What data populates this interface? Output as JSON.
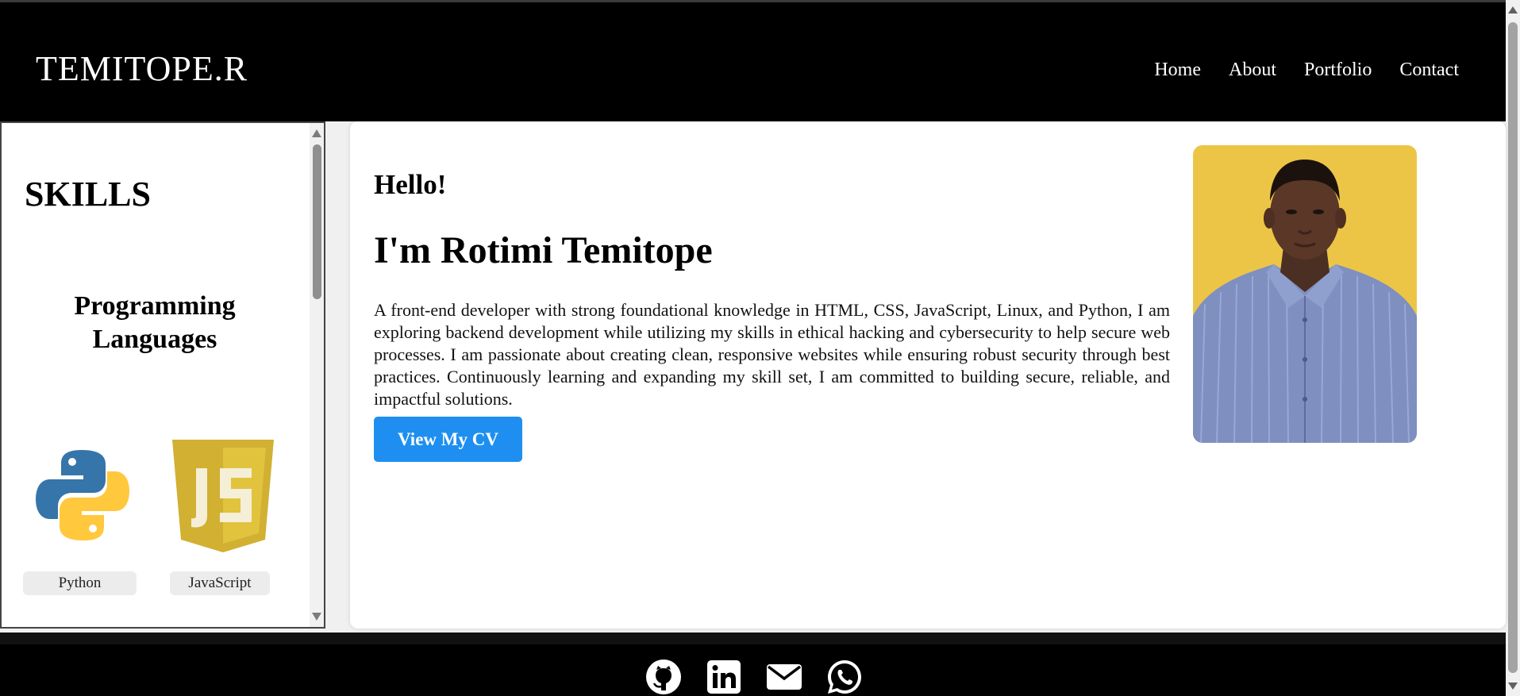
{
  "header": {
    "brand": "TEMITOPE.R",
    "nav": [
      "Home",
      "About",
      "Portfolio",
      "Contact"
    ]
  },
  "skills": {
    "title": "SKILLS",
    "section": "Programming Languages",
    "items": [
      {
        "label": "Python",
        "icon": "python-icon"
      },
      {
        "label": "JavaScript",
        "icon": "javascript-icon"
      }
    ]
  },
  "main": {
    "greeting": "Hello!",
    "name": "I'm Rotimi Temitope",
    "bio": "A front-end developer with strong foundational knowledge in HTML, CSS, JavaScript, Linux, and Python, I am exploring backend development while utilizing my skills in ethical hacking and cybersecurity to help secure web processes. I am passionate about creating clean, responsive websites while ensuring robust security through best practices. Continuously learning and expanding my skill set, I am committed to building secure, reliable, and impactful solutions.",
    "cv_button": "View My CV"
  },
  "footer": {
    "icons": [
      "github-icon",
      "linkedin-icon",
      "email-icon",
      "whatsapp-icon"
    ]
  },
  "colors": {
    "header_bg": "#000000",
    "button_bg": "#1e8ff0",
    "photo_bg": "#f0c94a"
  }
}
